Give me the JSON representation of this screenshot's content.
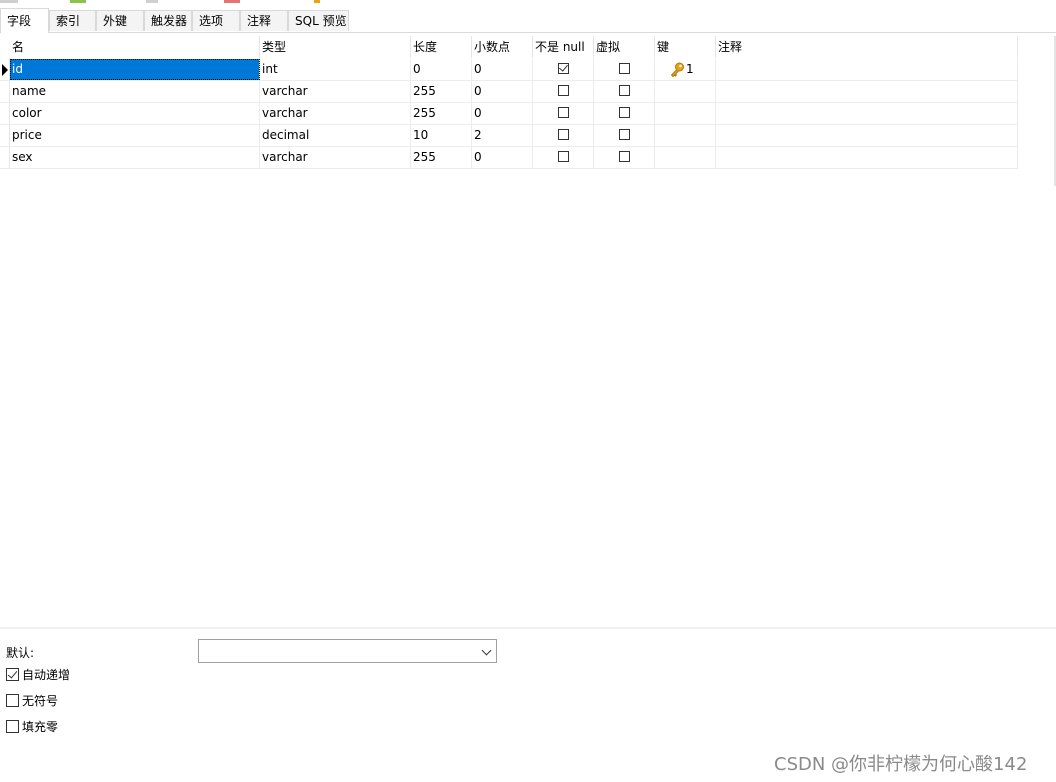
{
  "tabs": [
    "字段",
    "索引",
    "外键",
    "触发器",
    "选项",
    "注释",
    "SQL 预览"
  ],
  "columns": [
    "名",
    "类型",
    "长度",
    "小数点",
    "不是 null",
    "虚拟",
    "键",
    "注释"
  ],
  "rows": [
    {
      "name": "id",
      "type": "int",
      "length": "0",
      "decimals": "0",
      "not_null": true,
      "virtual": false,
      "key": "1",
      "comment": ""
    },
    {
      "name": "name",
      "type": "varchar",
      "length": "255",
      "decimals": "0",
      "not_null": false,
      "virtual": false,
      "key": "",
      "comment": ""
    },
    {
      "name": "color",
      "type": "varchar",
      "length": "255",
      "decimals": "0",
      "not_null": false,
      "virtual": false,
      "key": "",
      "comment": ""
    },
    {
      "name": "price",
      "type": "decimal",
      "length": "10",
      "decimals": "2",
      "not_null": false,
      "virtual": false,
      "key": "",
      "comment": ""
    },
    {
      "name": "sex",
      "type": "varchar",
      "length": "255",
      "decimals": "0",
      "not_null": false,
      "virtual": false,
      "key": "",
      "comment": ""
    }
  ],
  "bottom": {
    "default_label": "默认:",
    "default_value": "",
    "auto_increment_label": "自动递增",
    "auto_increment": true,
    "unsigned_label": "无符号",
    "unsigned": false,
    "zerofill_label": "填充零",
    "zerofill": false
  },
  "watermark": "CSDN @你非柠檬为何心酸142",
  "colors": {
    "selection": "#0078d7",
    "key_icon": "#e8a317"
  }
}
